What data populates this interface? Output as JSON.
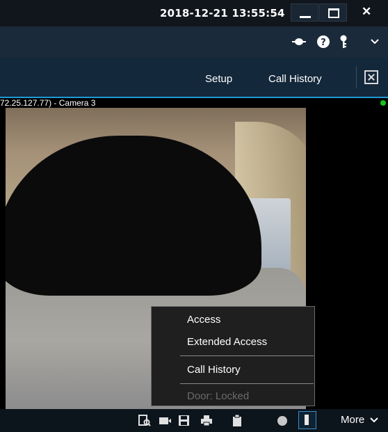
{
  "titlebar": {
    "datetime": "2018-12-21 13:55:54",
    "minimize_icon": "minimize-icon",
    "maximize_icon": "maximize-icon",
    "close_glyph": "✕"
  },
  "toolbar2": {
    "icons": [
      "connection-icon",
      "help-icon",
      "key-icon",
      "chevron-down-icon"
    ],
    "help_glyph": "?",
    "key_glyph": "⚷",
    "chevron_glyph": "⌄"
  },
  "nav": {
    "setup": "Setup",
    "call_history": "Call History",
    "fullscreen_icon": "fullscreen-icon"
  },
  "camera": {
    "title": "72.25.127.77) - Camera 3",
    "status_color": "#19c21a"
  },
  "menu": {
    "access": "Access",
    "extended_access": "Extended Access",
    "call_history": "Call History",
    "door_status": "Door: Locked"
  },
  "bottombar": {
    "icons": [
      "search-frame-icon",
      "video-camera-icon",
      "save-icon",
      "print-icon",
      "clipboard-icon",
      "record-icon",
      "door-icon"
    ],
    "more": "More",
    "more_glyph": "⌄"
  },
  "colors": {
    "accent": "#1e9bd7",
    "nav_bg": "#14283b"
  }
}
